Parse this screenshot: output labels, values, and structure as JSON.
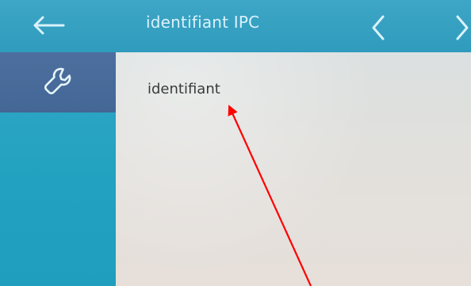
{
  "header": {
    "title": "identifiant IPC",
    "icons": {
      "back": "arrow-left-icon",
      "prev": "chevron-left-icon",
      "next": "chevron-right-icon"
    }
  },
  "sidebar": {
    "items": [
      {
        "icon": "wrench-icon",
        "selected": true
      }
    ]
  },
  "main": {
    "field_label": "identifiant"
  },
  "annotation": {
    "type": "red-arrow",
    "color": "#ff0000"
  },
  "colors": {
    "header": "#3ea6c6",
    "sidebar": "#23a2c0",
    "sidebar_selected": "#4d6f9f",
    "content_bg": "#e3e0dc",
    "title_text": "#d9f2fb",
    "content_text": "#3a3a3a",
    "annotation": "#ff0000"
  }
}
